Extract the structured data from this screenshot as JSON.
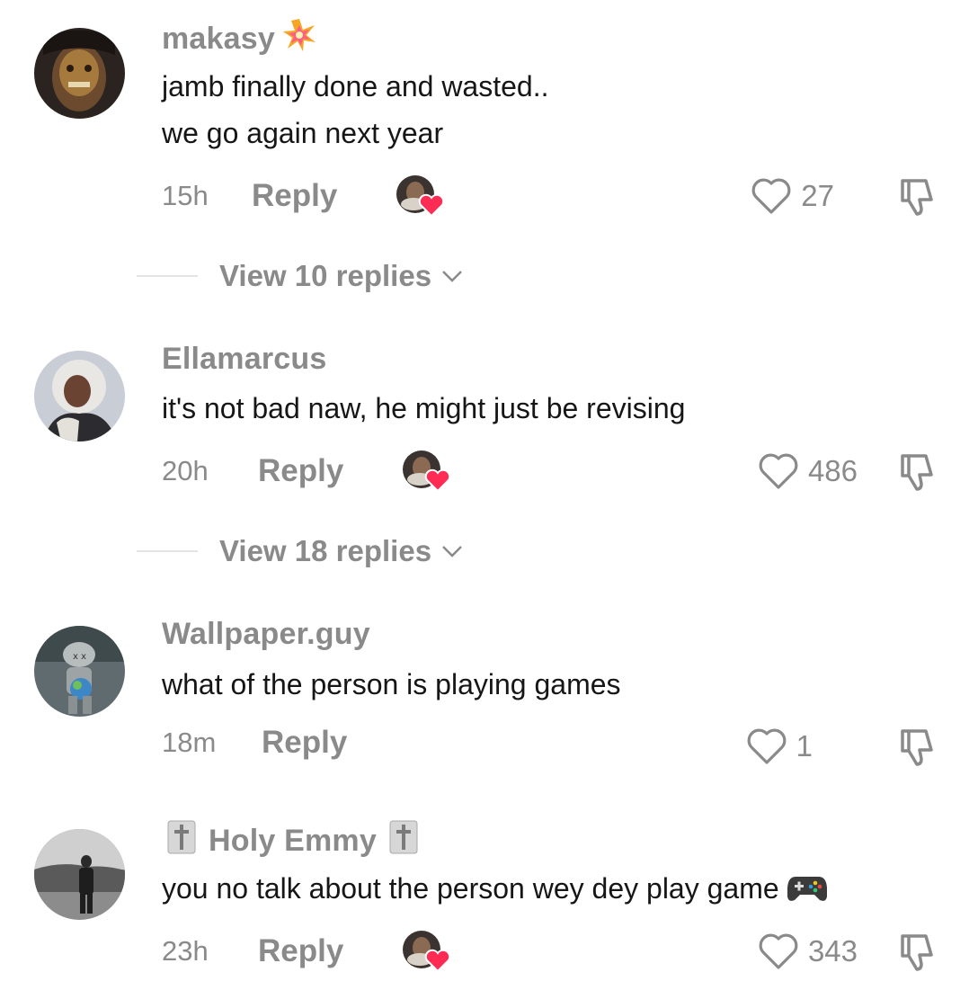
{
  "comments": [
    {
      "username": "makasy",
      "username_badge": "explosion-emoji",
      "lines": [
        "jamb finally done and wasted..",
        "we go again next year"
      ],
      "time": "15h",
      "reply_label": "Reply",
      "likes": "27",
      "view_replies": "View 10 replies"
    },
    {
      "username": "Ellamarcus",
      "lines": [
        "it's not bad naw, he might just be revising"
      ],
      "time": "20h",
      "reply_label": "Reply",
      "likes": "486",
      "view_replies": "View 18 replies"
    },
    {
      "username": "Wallpaper.guy",
      "lines": [
        "what of the person is playing games"
      ],
      "time": "18m",
      "reply_label": "Reply",
      "likes": "1"
    },
    {
      "username": "Holy Emmy",
      "username_badge": "cross-emoji",
      "lines": [
        "you no talk about the person wey dey play game"
      ],
      "text_emoji": "video-game-emoji",
      "time": "23h",
      "reply_label": "Reply",
      "likes": "343"
    }
  ],
  "colors": {
    "muted": "#8a8a8a",
    "text": "#161616",
    "heart_badge": "#fe2c55"
  }
}
